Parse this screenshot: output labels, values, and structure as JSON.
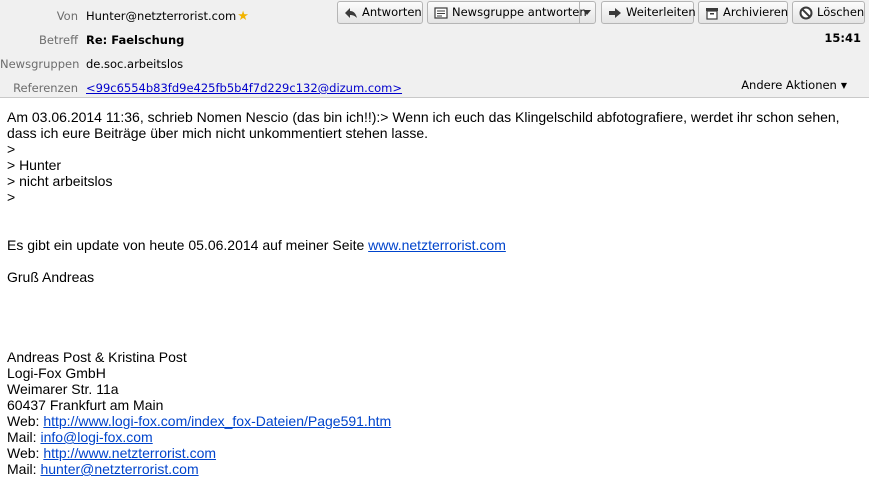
{
  "header": {
    "from_label": "Von",
    "from_value": "Hunter@netzterrorist.com",
    "subject_label": "Betreff",
    "subject_value": "Re: Faelschung",
    "newsgroups_label": "Newsgruppen",
    "newsgroups_value": "de.soc.arbeitslos",
    "references_label": "Referenzen",
    "references_value": "<99c6554b83fd9e425fb5b4f7d229c132@dizum.com>",
    "time": "15:41",
    "other_actions": "Andere Aktionen"
  },
  "toolbar": {
    "reply": "Antworten",
    "reply_newsgroup": "Newsgruppe antworten",
    "forward": "Weiterleiten",
    "archive": "Archivieren",
    "delete": "Löschen"
  },
  "body": {
    "quote_line1": "Am 03.06.2014 11:36, schrieb Nomen Nescio (das bin ich!!):> Wenn ich euch das Klingelschild abfotografiere, werdet ihr schon sehen,",
    "quote_line2": "dass ich eure Beiträge über mich nicht unkommentiert stehen lasse.",
    "quote_line3": ">",
    "quote_line4": "> Hunter",
    "quote_line5": "> nicht arbeitslos",
    "quote_line6": ">",
    "update_text": "Es gibt ein update von heute 05.06.2014 auf meiner Seite ",
    "update_link": "www.netzterrorist.com",
    "greeting": "Gruß Andreas",
    "sig_names": "Andreas  Post & Kristina  Post",
    "sig_company": "Logi-Fox GmbH",
    "sig_street": "Weimarer Str. 11a",
    "sig_city": "60437 Frankfurt am Main",
    "sig_web1_label": "Web: ",
    "sig_web1_link": "http://www.logi-fox.com/index_fox-Dateien/Page591.htm",
    "sig_mail1_label": "Mail: ",
    "sig_mail1_link": "info@logi-fox.com",
    "sig_web2_label": "Web: ",
    "sig_web2_link": "http://www.netzterrorist.com",
    "sig_mail2_label": "Mail: ",
    "sig_mail2_link": "hunter@netzterrorist.com"
  }
}
